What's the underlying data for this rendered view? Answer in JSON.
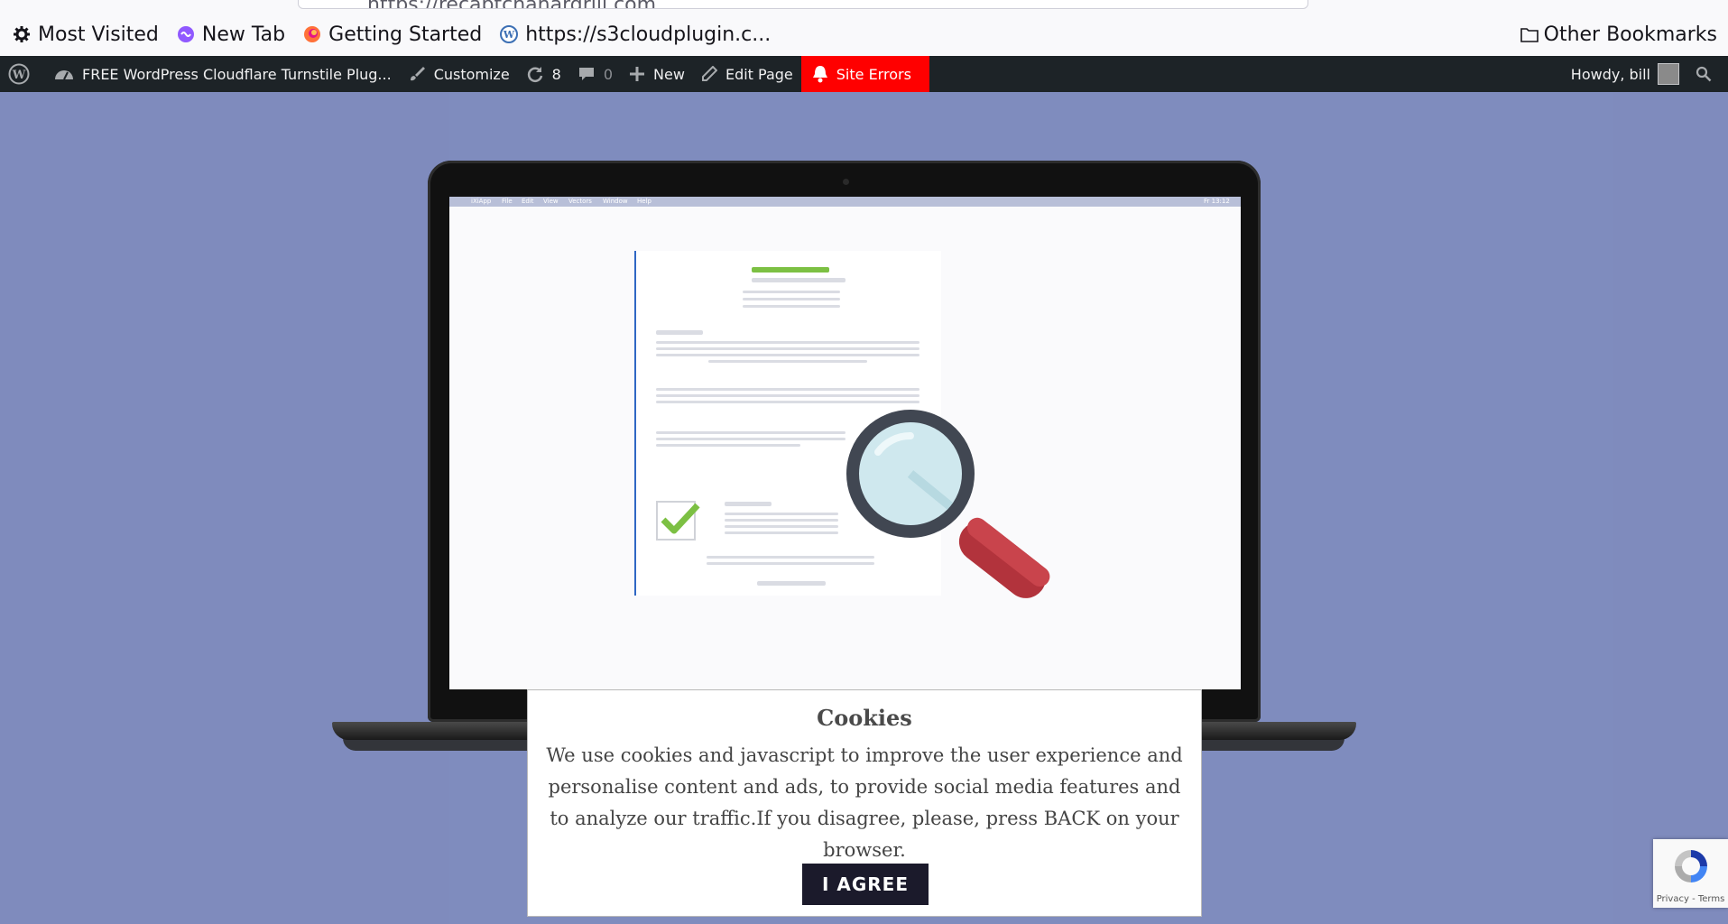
{
  "browser": {
    "url": "https://recaptchahardrill.com",
    "bookmarks": [
      {
        "label": "Most Visited",
        "icon": "gear-icon"
      },
      {
        "label": "New Tab",
        "icon": "new-tab-icon"
      },
      {
        "label": "Getting Started",
        "icon": "firefox-icon"
      },
      {
        "label": "https://s3cloudplugin.c...",
        "icon": "wordpress-icon"
      }
    ],
    "other_bookmarks": "Other Bookmarks"
  },
  "adminbar": {
    "site_name": "FREE WordPress Cloudflare Turnstile Plug...",
    "customize": "Customize",
    "updates_count": "8",
    "comments_count": "0",
    "new": "New",
    "edit_page": "Edit Page",
    "site_errors": "Site Errors",
    "howdy": "Howdy, bill",
    "error_color": "#ff0000"
  },
  "screen_menubar": {
    "items": [
      "iXiApp",
      "File",
      "Edit",
      "View",
      "Vectors",
      "Window",
      "Help"
    ],
    "clock": "Fr 13:12"
  },
  "cookie": {
    "title": "Cookies",
    "text": "We use cookies and javascript to improve the user experience and personalise content and ads, to provide social media features and to analyze our traffic.If you disagree, please, press BACK on your browser.",
    "button": "I AGREE"
  },
  "recaptcha": {
    "links": "Privacy - Terms"
  }
}
